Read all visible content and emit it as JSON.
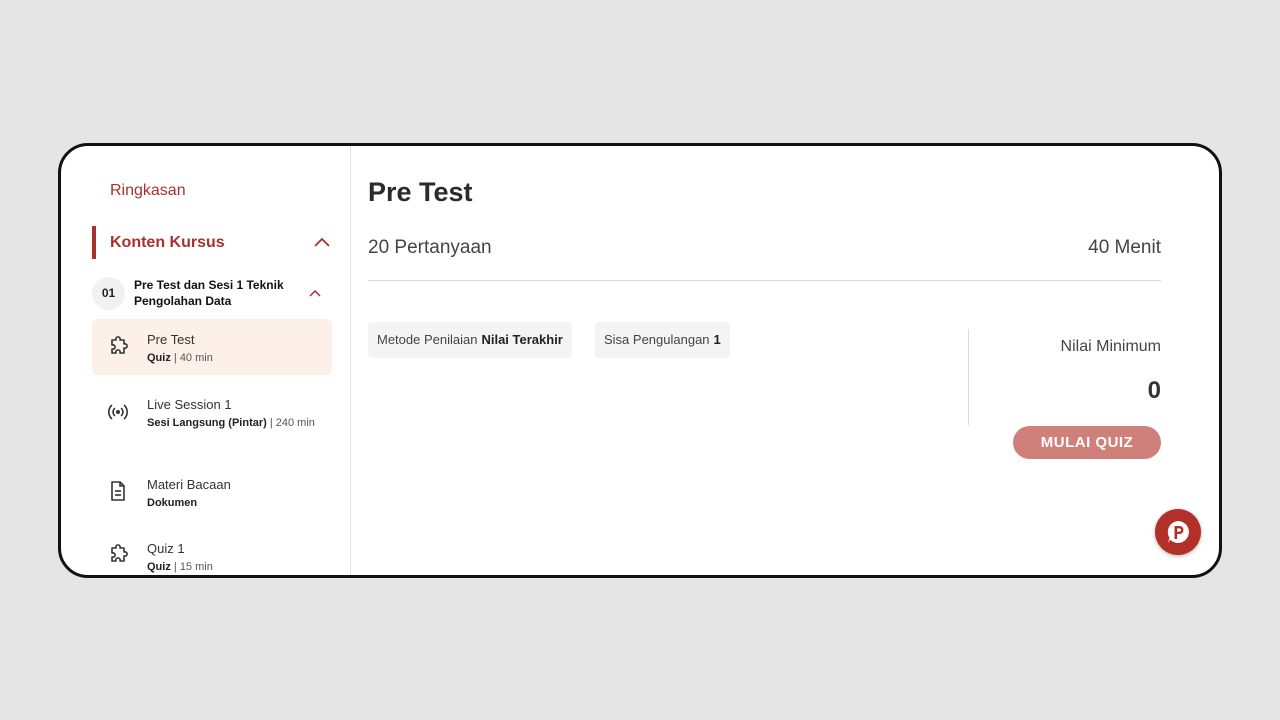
{
  "sidebar": {
    "ringkasan": "Ringkasan",
    "konten_kursus": "Konten Kursus",
    "section": {
      "number": "01",
      "title": "Pre Test dan Sesi 1 Teknik Pengolahan Data"
    },
    "items": [
      {
        "title": "Pre Test",
        "type": "Quiz",
        "detail": " | 40 min",
        "icon": "puzzle-icon",
        "active": true
      },
      {
        "title": "Live Session 1",
        "type": "Sesi Langsung (Pintar)",
        "detail": " | 240 min",
        "icon": "broadcast-icon",
        "active": false
      },
      {
        "title": "Materi Bacaan",
        "type": "Dokumen",
        "detail": "",
        "icon": "document-icon",
        "active": false
      },
      {
        "title": "Quiz 1",
        "type": "Quiz",
        "detail": " | 15 min",
        "icon": "puzzle-icon",
        "active": false
      }
    ]
  },
  "main": {
    "title": "Pre Test",
    "questions": "20 Pertanyaan",
    "duration": "40 Menit",
    "method_label": "Metode Penilaian",
    "method_value": "Nilai Terakhir",
    "remaining_label": "Sisa Pengulangan",
    "remaining_value": "1",
    "min_score_label": "Nilai Minimum",
    "min_score_value": "0",
    "start_button": "MULAI QUIZ"
  },
  "chat": {
    "icon": "chat-p-icon"
  },
  "colors": {
    "accent": "#a8322b",
    "button": "#d0807b",
    "active_bg": "#fcf0e8",
    "page_bg": "#e5e5e5"
  }
}
